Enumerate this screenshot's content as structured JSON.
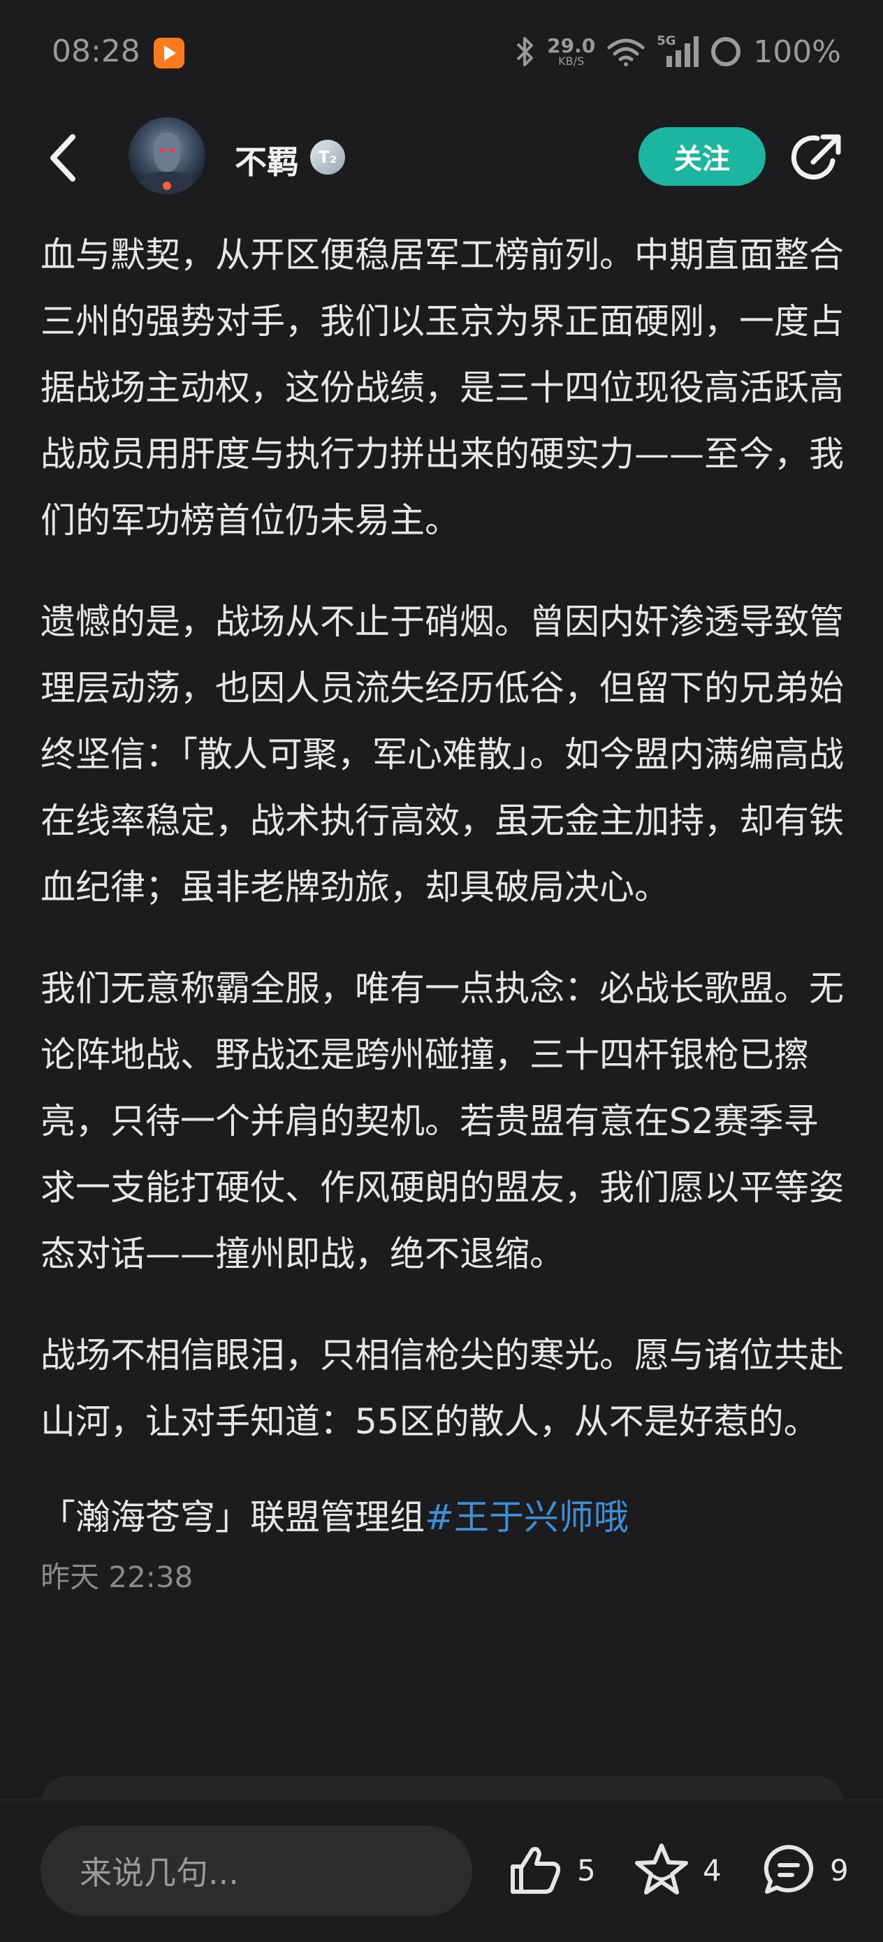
{
  "status_bar": {
    "time": "08:28",
    "net_speed_value": "29.0",
    "net_speed_unit": "KB/S",
    "network_label": "5G",
    "battery": "100%"
  },
  "header": {
    "username": "不羁",
    "level_badge": "T₂",
    "follow_label": "关注"
  },
  "post": {
    "paragraphs": [
      "血与默契，从开区便稳居军工榜前列。中期直面整合三州的强势对手，我们以玉京为界正面硬刚，一度占据战场主动权，这份战绩，是三十四位现役高活跃高战成员用肝度与执行力拼出来的硬实力——至今，我们的军功榜首位仍未易主。",
      "遗憾的是，战场从不止于硝烟。曾因内奸渗透导致管理层动荡，也因人员流失经历低谷，但留下的兄弟始终坚信：「散人可聚，军心难散」。如今盟内满编高战在线率稳定，战术执行高效，虽无金主加持，却有铁血纪律；虽非老牌劲旅，却具破局决心。",
      "我们无意称霸全服，唯有一点执念：必战长歌盟。无论阵地战、野战还是跨州碰撞，三十四杆银枪已擦亮，只待一个并肩的契机。若贵盟有意在S2赛季寻求一支能打硬仗、作风硬朗的盟友，我们愿以平等姿态对话——撞州即战，绝不退缩。",
      "战场不相信眼泪，只相信枪尖的寒光。愿与诸位共赴山河，让对手知道：55区的散人，从不是好惹的。"
    ],
    "signature": "「瀚海苍穹」联盟管理组",
    "hashtag": "#王于兴师哦",
    "timestamp": "昨天 22:38"
  },
  "bottom_bar": {
    "comment_placeholder": "来说几句...",
    "like_count": "5",
    "favorite_count": "4",
    "comment_count": "9"
  },
  "colors": {
    "background": "#1c1c1e",
    "accent_follow": "#1cb6a0",
    "hashtag": "#3f8fd8"
  },
  "icons": [
    "back-icon",
    "share-icon",
    "bluetooth-icon",
    "wifi-icon",
    "signal-icon",
    "battery-icon",
    "thumbs-up-icon",
    "star-icon",
    "comment-icon"
  ]
}
